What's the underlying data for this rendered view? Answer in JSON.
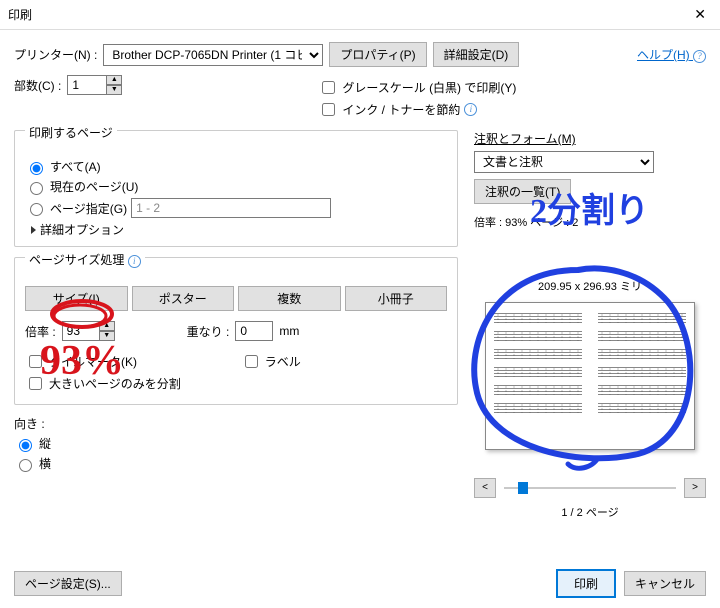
{
  "window": {
    "title": "印刷"
  },
  "toolbar": {
    "printer_label": "プリンター(N) :",
    "printer_value": "Brother DCP-7065DN Printer (1 コピー)",
    "properties": "プロパティ(P)",
    "advanced": "詳細設定(D)",
    "help": "ヘルプ(H)",
    "help_icon": "?"
  },
  "copies": {
    "label": "部数(C) :",
    "value": "1"
  },
  "options": {
    "grayscale": "グレースケール (白黒) で印刷(Y)",
    "save_ink": "インク / トナーを節約"
  },
  "range": {
    "legend": "印刷するページ",
    "all": "すべて(A)",
    "current": "現在のページ(U)",
    "pages": "ページ指定(G)",
    "pages_value": "1 - 2",
    "more": "詳細オプション"
  },
  "size": {
    "legend": "ページサイズ処理",
    "tab_size": "サイズ(I)",
    "tab_poster": "ポスター",
    "tab_multi": "複数",
    "tab_booklet": "小冊子",
    "scale_label": "倍率 :",
    "scale_value": "93",
    "overlap_label": "重なり :",
    "overlap_value": "0",
    "overlap_unit": "mm",
    "tilemark": "タイルマーク(K)",
    "label_chk": "ラベル",
    "bigpage": "大きいページのみを分割"
  },
  "orient": {
    "legend": "向き :",
    "portrait": "縦",
    "landscape": "横"
  },
  "forms": {
    "legend": "注釈とフォーム(M)",
    "value": "文書と注釈",
    "list_btn": "注釈の一覧(T)"
  },
  "preview": {
    "scale_line": "倍率 : 93% ページ : 2",
    "dimensions": "209.95 x 296.93 ミリ",
    "counter": "1 / 2 ページ",
    "prev": "<",
    "next": ">"
  },
  "footer": {
    "page_setup": "ページ設定(S)...",
    "print": "印刷",
    "cancel": "キャンセル"
  },
  "annotations": {
    "percent": "93%",
    "split": "2分割り"
  }
}
